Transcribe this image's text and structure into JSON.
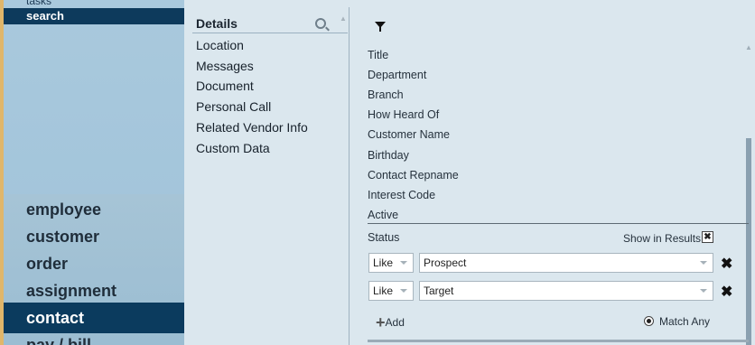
{
  "sidebar": {
    "task_label": "tasks",
    "selected_label": "search",
    "nav": [
      "employee",
      "customer",
      "order",
      "assignment",
      "contact",
      "pay / bill"
    ]
  },
  "details": {
    "title": "Details",
    "items": [
      "Location",
      "Messages",
      "Document",
      "Personal Call",
      "Related Vendor Info",
      "Custom Data"
    ]
  },
  "fields": [
    "Title",
    "Department",
    "Branch",
    "How Heard Of",
    "Customer Name",
    "Birthday",
    "Contact Repname",
    "Interest Code",
    "Active"
  ],
  "status": {
    "label": "Status",
    "show_in_results_label": "Show in Results",
    "show_in_results_checked": "✖",
    "rows": [
      {
        "operator": "Like",
        "value": "Prospect"
      },
      {
        "operator": "Like",
        "value": "Target"
      }
    ],
    "add_label": "Add",
    "match_label": "Match Any"
  },
  "colors": {
    "accent": "#e0b66a",
    "nav_active": "#0b3b5e",
    "sidebar": "#a9c9dd"
  }
}
